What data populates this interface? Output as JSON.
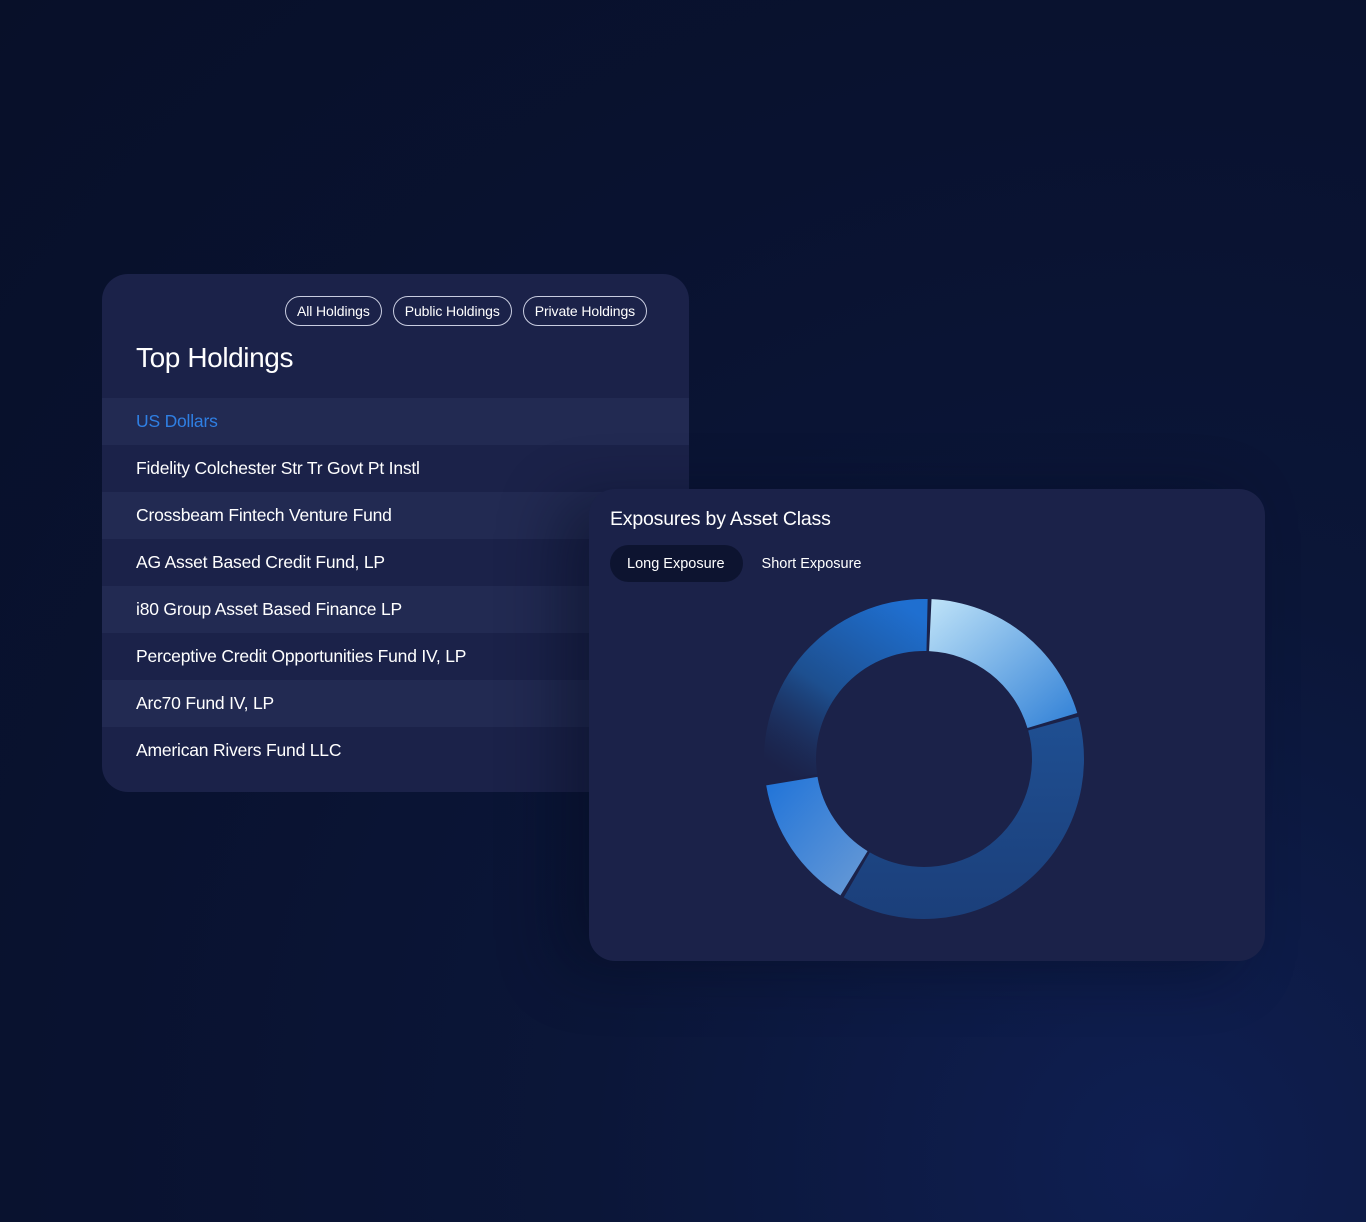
{
  "holdings_card": {
    "title": "Top Holdings",
    "filters": [
      "All Holdings",
      "Public Holdings",
      "Private Holdings"
    ],
    "group_header": "US Dollars",
    "holdings": [
      "Fidelity Colchester Str Tr Govt Pt Instl",
      "Crossbeam Fintech Venture Fund",
      "AG Asset Based Credit Fund, LP",
      "i80 Group Asset Based Finance LP",
      "Perceptive Credit Opportunities Fund IV, LP",
      "Arc70 Fund IV, LP",
      "American Rivers Fund LLC"
    ]
  },
  "exposure_card": {
    "title": "Exposures by Asset Class",
    "tabs": [
      "Long Exposure",
      "Short Exposure"
    ],
    "active_tab": "Long Exposure"
  },
  "colors": {
    "background": "#0a1430",
    "card": "#1b2249",
    "row_alt": "#222a52",
    "accent_blue": "#2f7fe3",
    "slice_light": "#8ec6f0",
    "slice_dark": "#1d4a8a",
    "slice_mid": "#2a75d6"
  },
  "chart_data": {
    "type": "pie",
    "subtype": "donut",
    "values": [
      20,
      38,
      14,
      28
    ],
    "colors": [
      "#8ec6f0",
      "#1d4a8a",
      "#2a75d6",
      "#2563b8"
    ],
    "start_angle_deg": 2,
    "legend": "none"
  }
}
